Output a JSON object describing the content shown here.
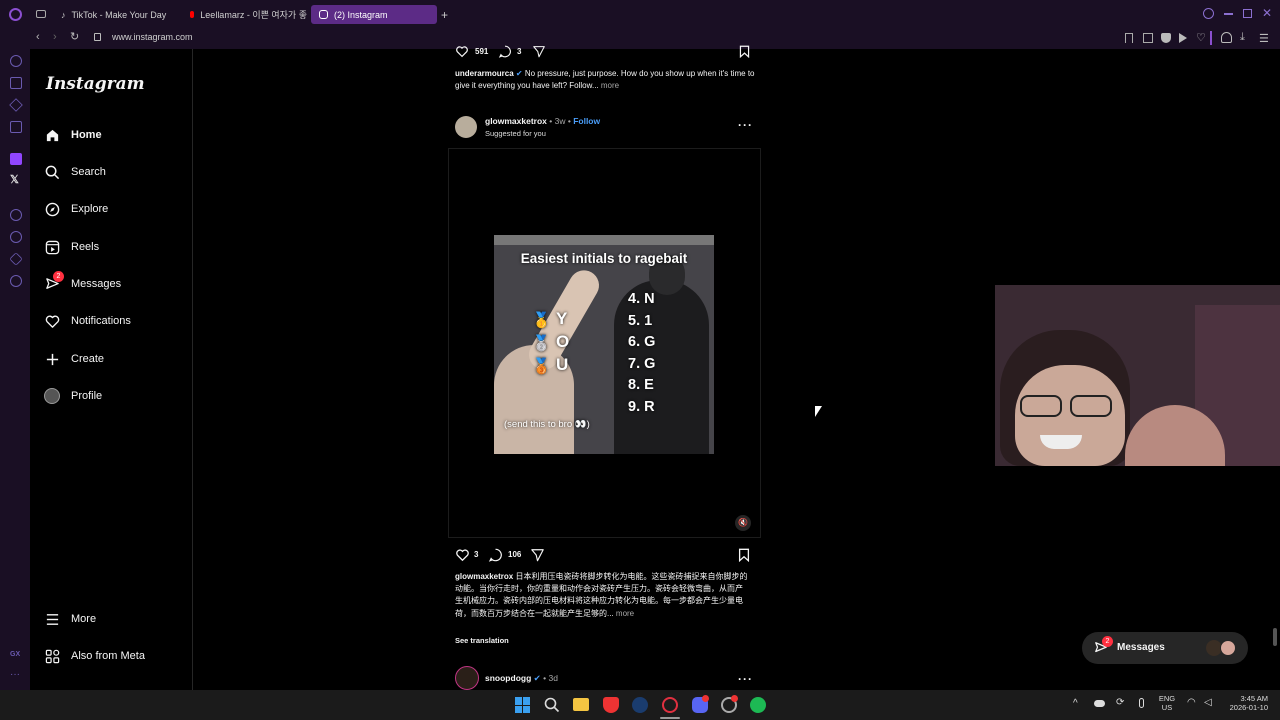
{
  "browser": {
    "tabs": [
      {
        "label": "TikTok - Make Your Day"
      },
      {
        "label": "Leellamarz - 이쁜 여자가 좋"
      },
      {
        "label": "(2) Instagram"
      }
    ],
    "url": "www.instagram.com"
  },
  "nav": {
    "logo": "Instagram",
    "items": [
      {
        "label": "Home"
      },
      {
        "label": "Search"
      },
      {
        "label": "Explore"
      },
      {
        "label": "Reels"
      },
      {
        "label": "Messages",
        "badge": "2"
      },
      {
        "label": "Notifications"
      },
      {
        "label": "Create"
      },
      {
        "label": "Profile"
      }
    ],
    "more": "More",
    "meta": "Also from Meta"
  },
  "prev_post": {
    "likes": "591",
    "comments": "3",
    "author": "underarmourca",
    "caption": "No pressure, just purpose. How do you show up when it's time to give it everything you have left? Follow...",
    "more": "more"
  },
  "post": {
    "author": "glowmaxketrox",
    "age": "3w",
    "follow": "Follow",
    "sub": "Suggested for you",
    "video": {
      "title": "Easiest initials to ragebait",
      "left_letters": [
        "Y",
        "O",
        "U"
      ],
      "right_list": [
        "4. N",
        "5. 1",
        "6. G",
        "7. G",
        "8. E",
        "9. R"
      ],
      "footer": "(send this to bro 👀)"
    },
    "likes": "3",
    "comments": "106",
    "caption_author": "glowmaxketrox",
    "caption": "日本利用压电瓷砖将脚步转化为电能。这些瓷砖捕捉来自你脚步的动能。当你行走时，你的重量和动作会对瓷砖产生压力。瓷砖会轻微弯曲，从而产生机械应力。瓷砖内部的压电材料将这种应力转化为电能。每一步都会产生少量电荷，而数百万步结合在一起就能产生足够的...",
    "more": "more",
    "translate": "See translation"
  },
  "next_post": {
    "author": "snoopdogg",
    "age": "3d"
  },
  "messages_float": {
    "label": "Messages",
    "badge": "2"
  },
  "taskbar": {
    "lang1": "ENG",
    "lang2": "US",
    "time": "3:45 AM",
    "date": "2026-01-10"
  },
  "colors": {
    "browser_bg": "#1a0f24",
    "tab_active": "#5c2b86",
    "link": "#4a9df8",
    "badge": "#ff3040"
  }
}
